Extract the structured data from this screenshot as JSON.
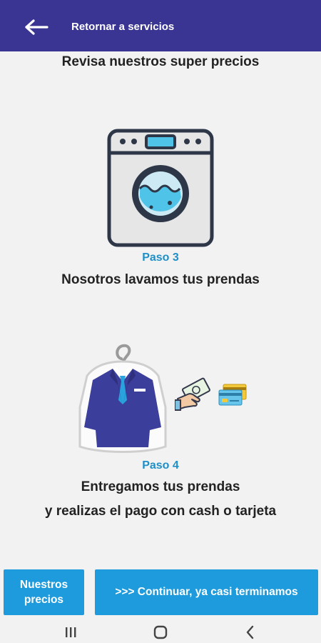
{
  "header": {
    "back_icon": "arrow-left-icon",
    "title": "Retornar a servicios"
  },
  "intro": {
    "text": "Revisa nuestros super precios"
  },
  "steps": [
    {
      "label": "Paso 3",
      "text": "Nosotros lavamos tus prendas",
      "icon": "washing-machine-icon"
    },
    {
      "label": "Paso 4",
      "line1": "Entregamos tus prendas",
      "line2": "y realizas el pago con cash o tarjeta",
      "icons": [
        "suit-on-hanger-icon",
        "hand-with-cash-icon",
        "credit-card-icon"
      ]
    }
  ],
  "buttons": {
    "prices_line1": "Nuestros",
    "prices_line2": "precios",
    "continue": ">>> Continuar, ya casi terminamos"
  },
  "system_nav": {
    "recents_icon": "recents-icon",
    "home_icon": "home-icon",
    "back_icon": "nav-back-icon"
  },
  "colors": {
    "header_bg": "#3a3593",
    "accent_blue": "#1e9bdc",
    "step_label": "#1f8fc8"
  }
}
